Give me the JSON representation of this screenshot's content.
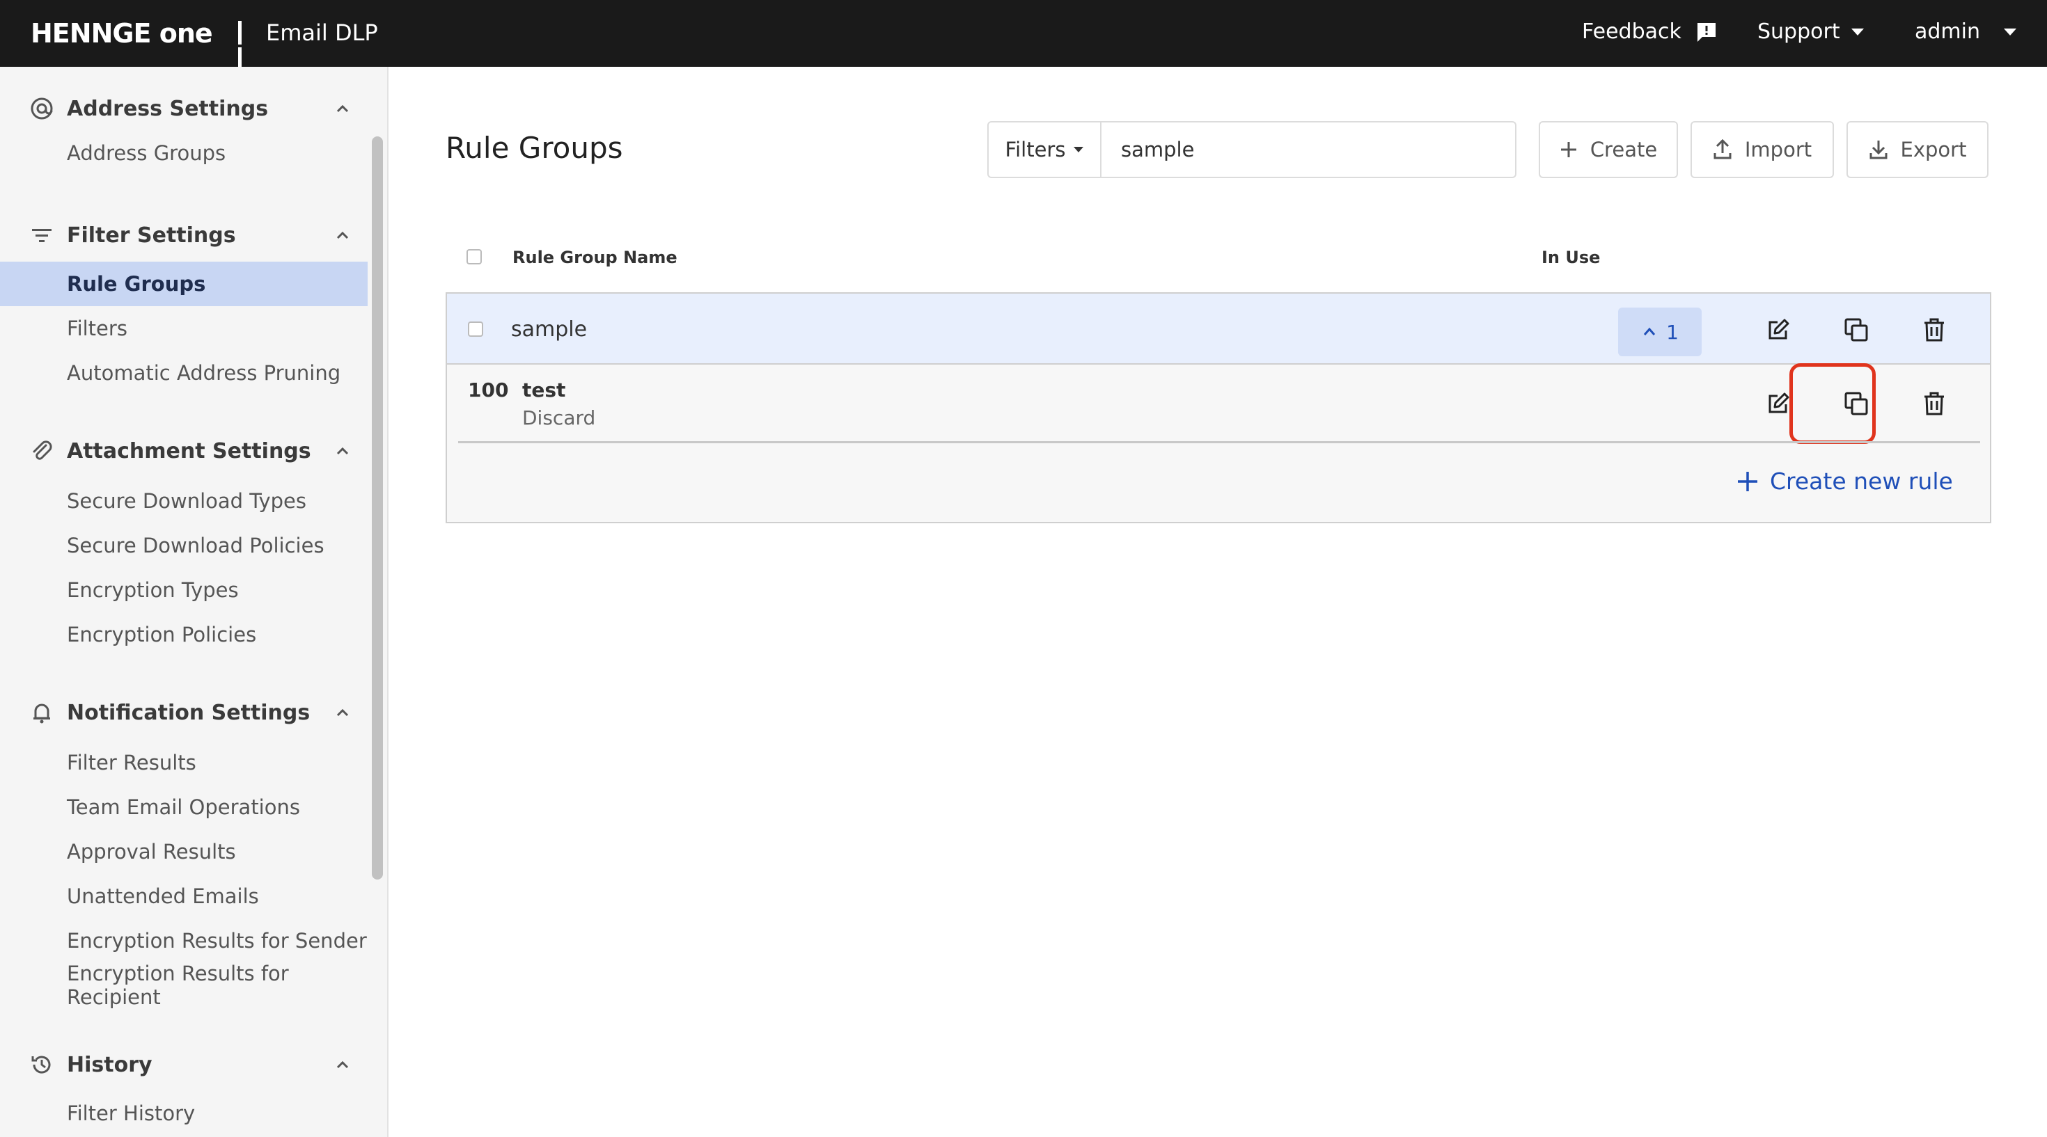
{
  "header": {
    "brand": "HENNGE one",
    "product": "Email DLP",
    "feedback": "Feedback",
    "support": "Support",
    "user": "admin"
  },
  "sidebar": {
    "sections": [
      {
        "title": "Address Settings",
        "icon": "at-icon",
        "items": [
          "Address Groups"
        ]
      },
      {
        "title": "Filter Settings",
        "icon": "filter-icon",
        "items": [
          "Rule Groups",
          "Filters",
          "Automatic Address Pruning"
        ]
      },
      {
        "title": "Attachment Settings",
        "icon": "paperclip-icon",
        "items": [
          "Secure Download Types",
          "Secure Download Policies",
          "Encryption Types",
          "Encryption Policies"
        ]
      },
      {
        "title": "Notification Settings",
        "icon": "bell-icon",
        "items": [
          "Filter Results",
          "Team Email Operations",
          "Approval Results",
          "Unattended Emails",
          "Encryption Results for Sender",
          "Encryption Results for Recipient"
        ]
      },
      {
        "title": "History",
        "icon": "history-icon",
        "items": [
          "Filter History"
        ]
      }
    ],
    "active_item": "Rule Groups"
  },
  "main": {
    "title": "Rule Groups",
    "filters_label": "Filters",
    "search_value": "sample",
    "buttons": {
      "create": "Create",
      "import": "Import",
      "export": "Export"
    },
    "columns": {
      "name": "Rule Group Name",
      "in_use": "In Use"
    },
    "groups": [
      {
        "name": "sample",
        "in_use_count": "1",
        "rules": [
          {
            "priority": "100",
            "name": "test",
            "action": "Discard"
          }
        ]
      }
    ],
    "create_rule": "Create new rule"
  },
  "colors": {
    "topbar": "#1a1a1a",
    "accent": "#1f4fb8",
    "active_nav": "#c8d6f3",
    "group_row": "#e8effd",
    "highlight": "#e0341d"
  }
}
